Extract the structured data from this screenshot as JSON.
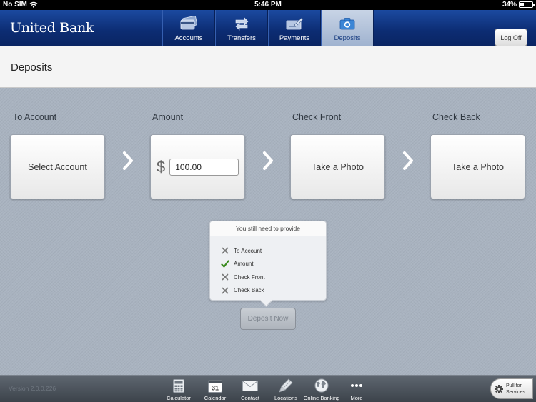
{
  "status_bar": {
    "carrier": "No SIM",
    "time": "5:46 PM",
    "battery": "34%",
    "battery_level": 0.34
  },
  "header": {
    "bank_name": "United Bank",
    "tabs": [
      {
        "label": "Accounts",
        "icon": "credit-card-icon",
        "active": false
      },
      {
        "label": "Transfers",
        "icon": "transfer-arrows-icon",
        "active": false
      },
      {
        "label": "Payments",
        "icon": "check-pen-icon",
        "active": false
      },
      {
        "label": "Deposits",
        "icon": "camera-icon",
        "active": true
      }
    ],
    "log_off_label": "Log Off"
  },
  "page": {
    "title": "Deposits"
  },
  "steps": {
    "to_account": {
      "label": "To Account",
      "button": "Select Account"
    },
    "amount": {
      "label": "Amount",
      "currency": "$",
      "value": "100.00"
    },
    "check_front": {
      "label": "Check Front",
      "button": "Take a Photo"
    },
    "check_back": {
      "label": "Check Back",
      "button": "Take a Photo"
    }
  },
  "requirements": {
    "header": "You still need to provide",
    "items": [
      {
        "label": "To Account",
        "done": false
      },
      {
        "label": "Amount",
        "done": true
      },
      {
        "label": "Check Front",
        "done": false
      },
      {
        "label": "Check Back",
        "done": false
      }
    ]
  },
  "deposit_button": "Deposit Now",
  "toolbar": {
    "version": "Version 2.0.0.226",
    "tools": [
      {
        "label": "Calculator",
        "icon": "calculator-icon"
      },
      {
        "label": "Calendar",
        "icon": "calendar-icon",
        "day": "31"
      },
      {
        "label": "Contact",
        "icon": "envelope-icon"
      },
      {
        "label": "Locations",
        "icon": "map-pin-icon"
      },
      {
        "label": "Online Banking",
        "icon": "globe-icon"
      },
      {
        "label": "More",
        "icon": "more-dots-icon"
      }
    ],
    "pull_line1": "Pull for",
    "pull_line2": "Services"
  },
  "colors": {
    "header_blue": "#0c2c72",
    "active_tab": "#b6c4da",
    "check_green": "#3a8a1e",
    "background": "#a9b3c0"
  }
}
